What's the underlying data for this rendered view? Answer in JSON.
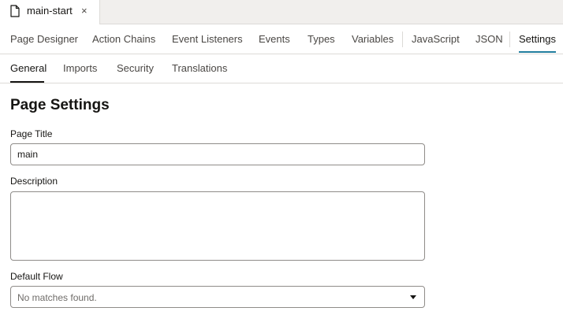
{
  "file_tab": {
    "label": "main-start",
    "close_symbol": "×",
    "icon": "file-icon"
  },
  "designer_tabs": [
    {
      "label": "Page Designer"
    },
    {
      "label": "Action Chains"
    },
    {
      "label": "Event Listeners"
    },
    {
      "label": "Events"
    },
    {
      "label": "Types"
    },
    {
      "label": "Variables"
    },
    {
      "label": "JavaScript"
    },
    {
      "label": "JSON"
    },
    {
      "label": "Settings"
    }
  ],
  "designer_active_tab": "Settings",
  "settings_tabs": [
    {
      "label": "General"
    },
    {
      "label": "Imports"
    },
    {
      "label": "Security"
    },
    {
      "label": "Translations"
    }
  ],
  "settings_active_tab": "General",
  "page_settings": {
    "heading": "Page Settings",
    "page_title_label": "Page Title",
    "page_title_value": "main",
    "description_label": "Description",
    "description_value": "",
    "default_flow_label": "Default Flow",
    "default_flow_value": "No matches found."
  },
  "colors": {
    "accent": "#227e9e",
    "tabstrip_bg": "#f1efed",
    "border": "#dcdad7"
  }
}
